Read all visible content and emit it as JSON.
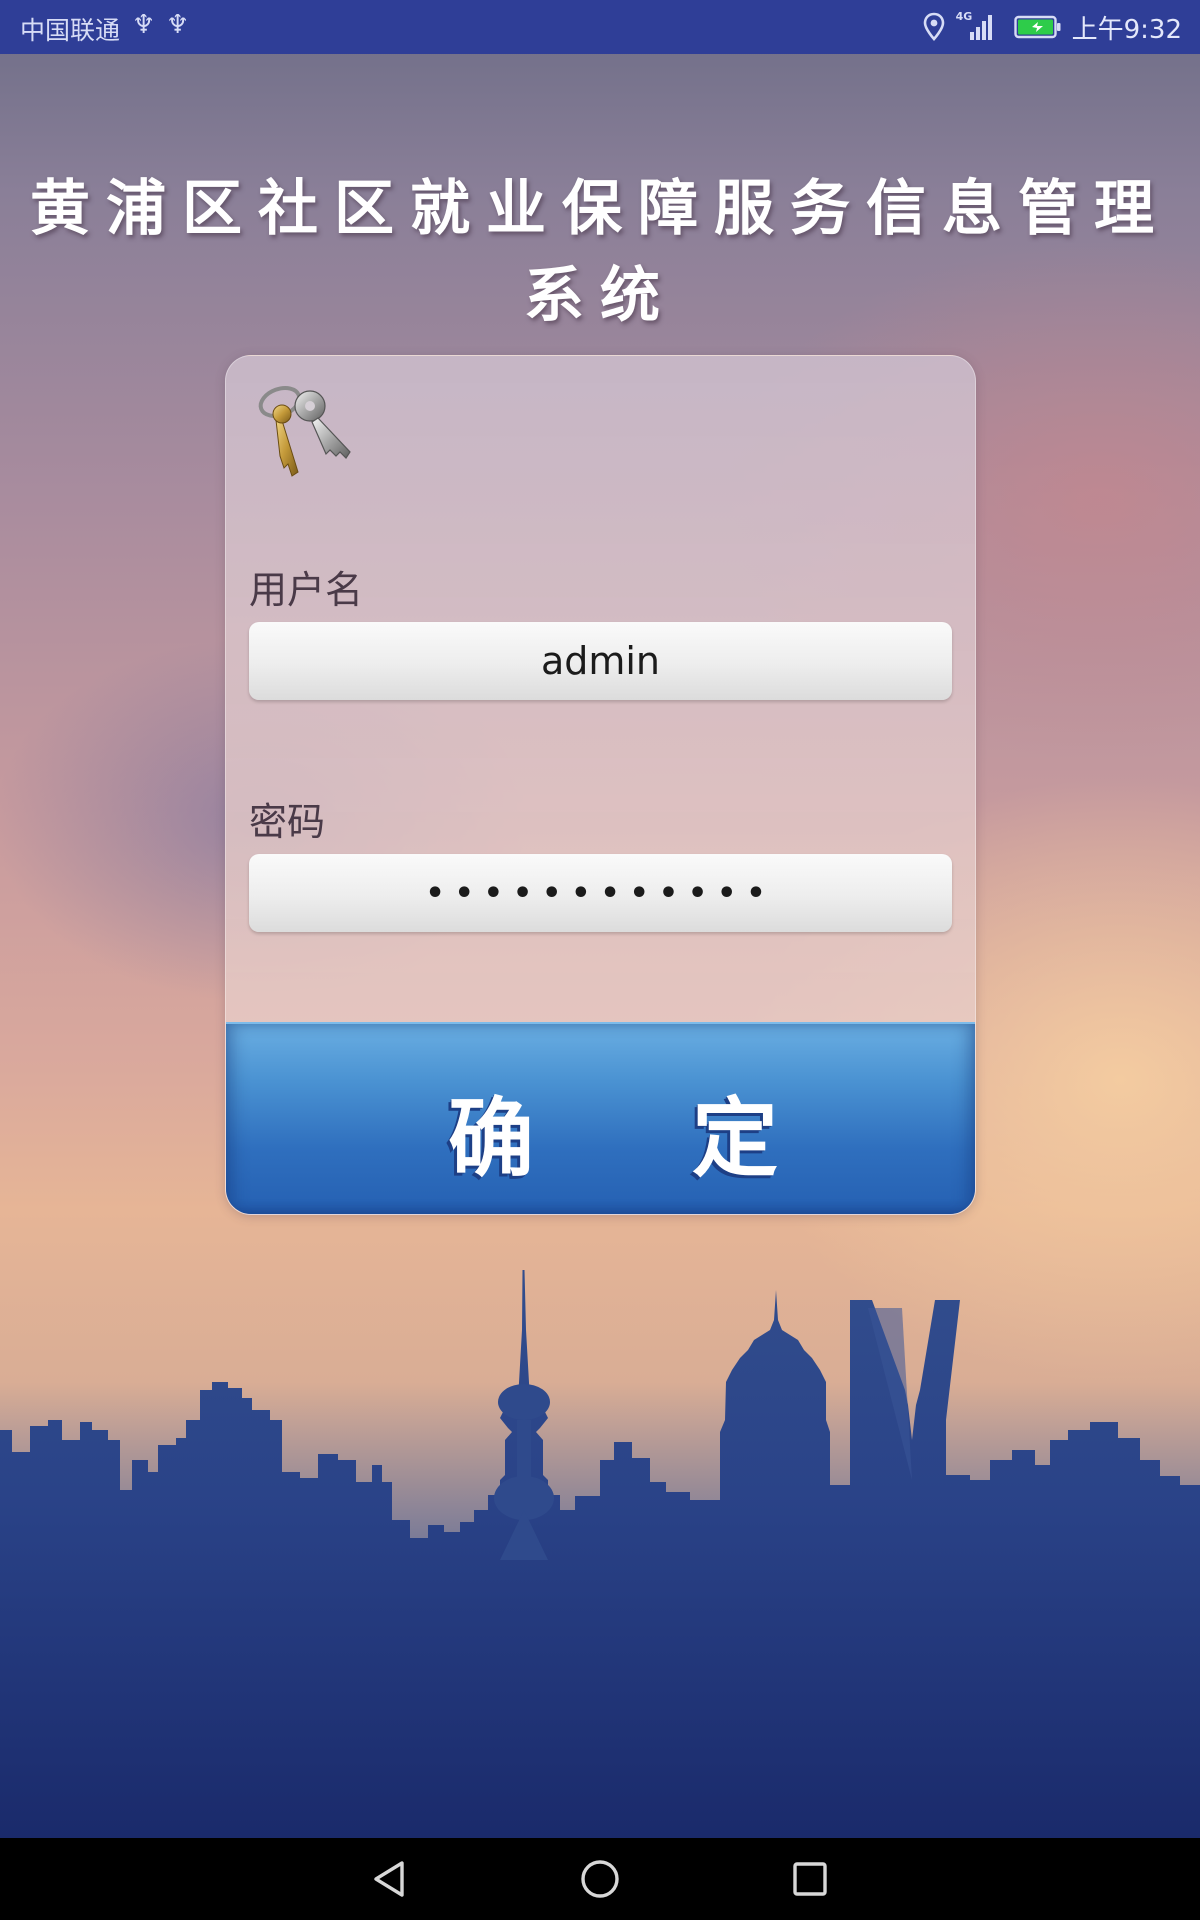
{
  "status_bar": {
    "carrier": "中国联通",
    "usb_icon_glyph": "♆",
    "network_label": "4G",
    "time": "上午9:32",
    "icons": [
      "usb-icon",
      "usb-icon",
      "location-icon",
      "signal-icon",
      "battery-icon"
    ],
    "battery_color": "#2ecc4a"
  },
  "app": {
    "title": "黄浦区社区就业保障服务信息管理系统"
  },
  "login": {
    "username_label": "用户名",
    "username_value": "admin",
    "password_label": "密码",
    "password_masked": "••••••••••••",
    "confirm_char_1": "确",
    "confirm_char_2": "定",
    "confirm_color": "#2f6fbe"
  },
  "nav_bar": {
    "icons": [
      "back-icon",
      "home-icon",
      "recents-icon"
    ]
  }
}
